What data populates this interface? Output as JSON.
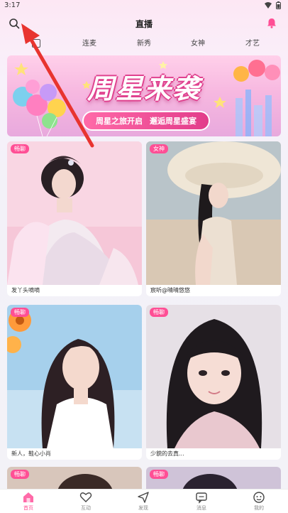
{
  "status_bar": {
    "time": "3:17"
  },
  "header": {
    "title": "直播"
  },
  "tabs": [
    {
      "label": "",
      "active": true
    },
    {
      "label": "连麦"
    },
    {
      "label": "新秀"
    },
    {
      "label": "女神"
    },
    {
      "label": "才艺"
    }
  ],
  "banner": {
    "title": "周星来袭",
    "pill_left": "周星之旅开启",
    "pill_right": "邂逅周星盛宴"
  },
  "cards": [
    {
      "tag": "畅聊",
      "name": "发丫头嘀嘀"
    },
    {
      "tag": "女神",
      "name": "宸听@晴晴悠悠"
    },
    {
      "tag": "畅聊",
      "name": "新人，鞋心小肖"
    },
    {
      "tag": "畅聊",
      "name": "少貌的去真..."
    },
    {
      "tag": "畅聊",
      "name": ""
    },
    {
      "tag": "畅聊",
      "name": ""
    }
  ],
  "bottom_nav": [
    {
      "label": "首页",
      "icon": "home-icon",
      "active": true
    },
    {
      "label": "互动",
      "icon": "heart-icon"
    },
    {
      "label": "发现",
      "icon": "send-icon"
    },
    {
      "label": "消息",
      "icon": "message-icon"
    },
    {
      "label": "我的",
      "icon": "profile-icon"
    }
  ],
  "colors": {
    "accent": "#ff4f95",
    "arrow": "#e8342f"
  }
}
